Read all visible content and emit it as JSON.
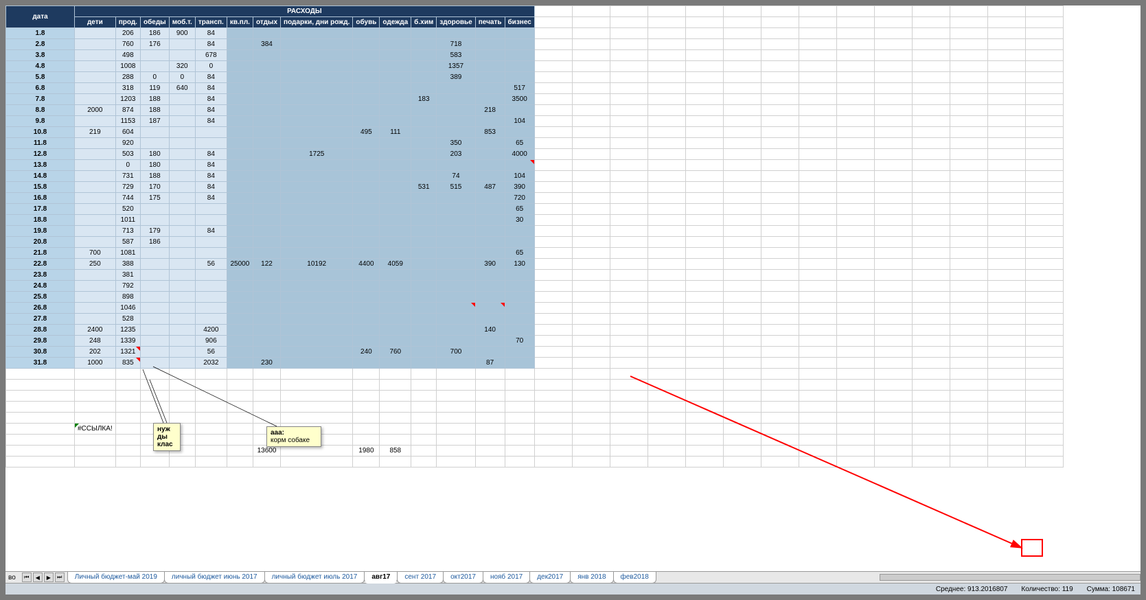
{
  "title": "РАСХОДЫ",
  "dateHeader": "дата",
  "columns": [
    "дети",
    "прод.",
    "обеды",
    "моб.т.",
    "трансп.",
    "кв.пл.",
    "отдых",
    "подарки, дни рожд.",
    "обувь",
    "одежда",
    "б.хим",
    "здоровье",
    "печать",
    "бизнес"
  ],
  "rows": [
    {
      "date": "1.8",
      "v": [
        "",
        "206",
        "186",
        "900",
        "84",
        "",
        "",
        "",
        "",
        "",
        "",
        "",
        "",
        ""
      ]
    },
    {
      "date": "2.8",
      "v": [
        "",
        "760",
        "176",
        "",
        "84",
        "",
        "384",
        "",
        "",
        "",
        "",
        "718",
        "",
        ""
      ]
    },
    {
      "date": "3.8",
      "v": [
        "",
        "498",
        "",
        "",
        "678",
        "",
        "",
        "",
        "",
        "",
        "",
        "583",
        "",
        ""
      ]
    },
    {
      "date": "4.8",
      "v": [
        "",
        "1008",
        "",
        "320",
        "0",
        "",
        "",
        "",
        "",
        "",
        "",
        "1357",
        "",
        ""
      ]
    },
    {
      "date": "5.8",
      "v": [
        "",
        "288",
        "0",
        "0",
        "84",
        "",
        "",
        "",
        "",
        "",
        "",
        "389",
        "",
        ""
      ]
    },
    {
      "date": "6.8",
      "v": [
        "",
        "318",
        "119",
        "640",
        "84",
        "",
        "",
        "",
        "",
        "",
        "",
        "",
        "",
        "517"
      ]
    },
    {
      "date": "7.8",
      "v": [
        "",
        "1203",
        "188",
        "",
        "84",
        "",
        "",
        "",
        "",
        "",
        "183",
        "",
        "",
        "3500"
      ]
    },
    {
      "date": "8.8",
      "v": [
        "2000",
        "874",
        "188",
        "",
        "84",
        "",
        "",
        "",
        "",
        "",
        "",
        "",
        "218",
        ""
      ]
    },
    {
      "date": "9.8",
      "v": [
        "",
        "1153",
        "187",
        "",
        "84",
        "",
        "",
        "",
        "",
        "",
        "",
        "",
        "",
        "104"
      ]
    },
    {
      "date": "10.8",
      "v": [
        "219",
        "604",
        "",
        "",
        "",
        "",
        "",
        "",
        "495",
        "111",
        "",
        "",
        "853",
        ""
      ]
    },
    {
      "date": "11.8",
      "v": [
        "",
        "920",
        "",
        "",
        "",
        "",
        "",
        "",
        "",
        "",
        "",
        "350",
        "",
        "65"
      ]
    },
    {
      "date": "12.8",
      "v": [
        "",
        "503",
        "180",
        "",
        "84",
        "",
        "",
        "1725",
        "",
        "",
        "",
        "203",
        "",
        "4000"
      ]
    },
    {
      "date": "13.8",
      "v": [
        "",
        "0",
        "180",
        "",
        "84",
        "",
        "",
        "",
        "",
        "",
        "",
        "",
        "",
        ""
      ]
    },
    {
      "date": "14.8",
      "v": [
        "",
        "731",
        "188",
        "",
        "84",
        "",
        "",
        "",
        "",
        "",
        "",
        "74",
        "",
        "104"
      ]
    },
    {
      "date": "15.8",
      "v": [
        "",
        "729",
        "170",
        "",
        "84",
        "",
        "",
        "",
        "",
        "",
        "531",
        "515",
        "487",
        "390"
      ]
    },
    {
      "date": "16.8",
      "v": [
        "",
        "744",
        "175",
        "",
        "84",
        "",
        "",
        "",
        "",
        "",
        "",
        "",
        "",
        "720"
      ]
    },
    {
      "date": "17.8",
      "v": [
        "",
        "520",
        "",
        "",
        "",
        "",
        "",
        "",
        "",
        "",
        "",
        "",
        "",
        "65"
      ]
    },
    {
      "date": "18.8",
      "v": [
        "",
        "1011",
        "",
        "",
        "",
        "",
        "",
        "",
        "",
        "",
        "",
        "",
        "",
        "30"
      ]
    },
    {
      "date": "19.8",
      "v": [
        "",
        "713",
        "179",
        "",
        "84",
        "",
        "",
        "",
        "",
        "",
        "",
        "",
        "",
        ""
      ]
    },
    {
      "date": "20.8",
      "v": [
        "",
        "587",
        "186",
        "",
        "",
        "",
        "",
        "",
        "",
        "",
        "",
        "",
        "",
        ""
      ]
    },
    {
      "date": "21.8",
      "v": [
        "700",
        "1081",
        "",
        "",
        "",
        "",
        "",
        "",
        "",
        "",
        "",
        "",
        "",
        "65"
      ]
    },
    {
      "date": "22.8",
      "v": [
        "250",
        "388",
        "",
        "",
        "56",
        "25000",
        "122",
        "10192",
        "4400",
        "4059",
        "",
        "",
        "390",
        "130"
      ]
    },
    {
      "date": "23.8",
      "v": [
        "",
        "381",
        "",
        "",
        "",
        "",
        "",
        "",
        "",
        "",
        "",
        "",
        "",
        ""
      ]
    },
    {
      "date": "24.8",
      "v": [
        "",
        "792",
        "",
        "",
        "",
        "",
        "",
        "",
        "",
        "",
        "",
        "",
        "",
        ""
      ]
    },
    {
      "date": "25.8",
      "v": [
        "",
        "898",
        "",
        "",
        "",
        "",
        "",
        "",
        "",
        "",
        "",
        "",
        "",
        ""
      ]
    },
    {
      "date": "26.8",
      "v": [
        "",
        "1046",
        "",
        "",
        "",
        "",
        "",
        "",
        "",
        "",
        "",
        "",
        "",
        ""
      ]
    },
    {
      "date": "27.8",
      "v": [
        "",
        "528",
        "",
        "",
        "",
        "",
        "",
        "",
        "",
        "",
        "",
        "",
        "",
        ""
      ]
    },
    {
      "date": "28.8",
      "v": [
        "2400",
        "1235",
        "",
        "",
        "4200",
        "",
        "",
        "",
        "",
        "",
        "",
        "",
        "140",
        ""
      ]
    },
    {
      "date": "29.8",
      "v": [
        "248",
        "1339",
        "",
        "",
        "906",
        "",
        "",
        "",
        "",
        "",
        "",
        "",
        "",
        "70"
      ]
    },
    {
      "date": "30.8",
      "v": [
        "202",
        "1321",
        "",
        "",
        "56",
        "",
        "",
        "",
        "240",
        "760",
        "",
        "700",
        "",
        ""
      ]
    },
    {
      "date": "31.8",
      "v": [
        "1000",
        "835",
        "",
        "",
        "2032",
        "",
        "230",
        "",
        "",
        "",
        "",
        "",
        "87",
        ""
      ]
    }
  ],
  "errorText": "#ССЫЛКА!",
  "bottomRow": [
    "",
    "",
    "",
    "",
    "",
    "",
    "13600",
    "",
    "1980",
    "858",
    "",
    "",
    "",
    ""
  ],
  "annotation1": "нуж\nды\nклас",
  "annotation2_title": "aaa:",
  "annotation2_text": "корм собаке",
  "tabs": [
    "Личный бюджет-май 2019",
    "личный бюджет июнь 2017",
    "личный бюджет  июль 2017",
    "авг17",
    "сент 2017",
    "окт2017",
    "нояб 2017",
    "дек2017",
    "янв 2018",
    "фев2018"
  ],
  "activeTab": 3,
  "tabNavLabel": "во",
  "status": {
    "avg_label": "Среднее:",
    "avg": "913.2016807",
    "count_label": "Количество:",
    "count": "119",
    "sum_label": "Сумма:",
    "sum": "108671"
  },
  "shadedCols": [
    5,
    6,
    7,
    8,
    9,
    10,
    11,
    12,
    13
  ]
}
